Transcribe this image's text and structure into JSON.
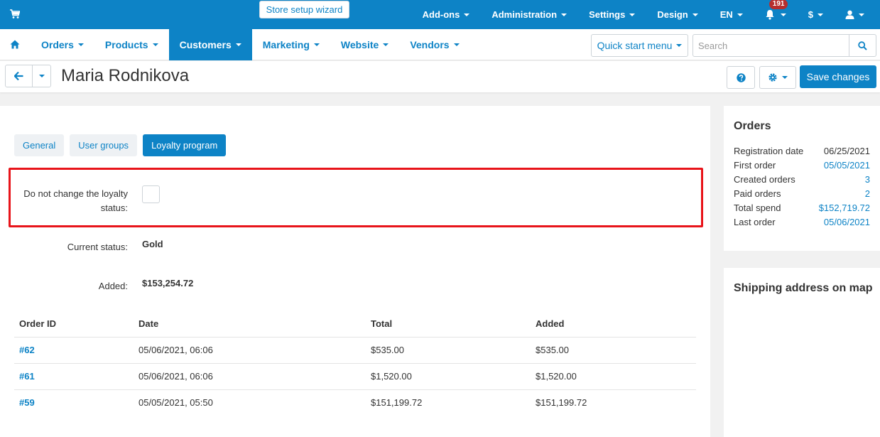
{
  "topbar": {
    "wizard_label": "Store setup wizard",
    "menu": [
      "Add-ons",
      "Administration",
      "Settings",
      "Design",
      "EN"
    ],
    "notifications_count": "191",
    "currency": "$"
  },
  "navbar": {
    "items": [
      {
        "label": "Orders",
        "active": false
      },
      {
        "label": "Products",
        "active": false
      },
      {
        "label": "Customers",
        "active": true
      },
      {
        "label": "Marketing",
        "active": false
      },
      {
        "label": "Website",
        "active": false
      },
      {
        "label": "Vendors",
        "active": false
      }
    ],
    "quick_start_label": "Quick start menu",
    "search_placeholder": "Search"
  },
  "titlebar": {
    "title": "Maria Rodnikova",
    "save_label": "Save changes"
  },
  "tabs": [
    {
      "label": "General",
      "active": false
    },
    {
      "label": "User groups",
      "active": false
    },
    {
      "label": "Loyalty program",
      "active": true
    }
  ],
  "loyalty": {
    "no_change_label_line1": "Do not change the loyalty",
    "no_change_label_line2": "status:",
    "no_change_checked": false,
    "current_status_label": "Current status:",
    "current_status_value": "Gold",
    "added_label": "Added:",
    "added_value": "$153,254.72"
  },
  "orders_table": {
    "headers": [
      "Order ID",
      "Date",
      "Total",
      "Added"
    ],
    "rows": [
      {
        "id": "#62",
        "date": "05/06/2021, 06:06",
        "total": "$535.00",
        "added": "$535.00"
      },
      {
        "id": "#61",
        "date": "05/06/2021, 06:06",
        "total": "$1,520.00",
        "added": "$1,520.00"
      },
      {
        "id": "#59",
        "date": "05/05/2021, 05:50",
        "total": "$151,199.72",
        "added": "$151,199.72"
      }
    ]
  },
  "orders_summary": {
    "title": "Orders",
    "rows": [
      {
        "label": "Registration date",
        "value": "06/25/2021",
        "link": false
      },
      {
        "label": "First order",
        "value": "05/05/2021",
        "link": true
      },
      {
        "label": "Created orders",
        "value": "3",
        "link": true
      },
      {
        "label": "Paid orders",
        "value": "2",
        "link": true
      },
      {
        "label": "Total spend",
        "value": "$152,719.72",
        "link": true
      },
      {
        "label": "Last order",
        "value": "05/06/2021",
        "link": true
      }
    ]
  },
  "shipping_map": {
    "title": "Shipping address on map"
  },
  "colors": {
    "accent": "#0d83c6",
    "highlight": "#e8141a",
    "badge": "#b62e2e"
  }
}
